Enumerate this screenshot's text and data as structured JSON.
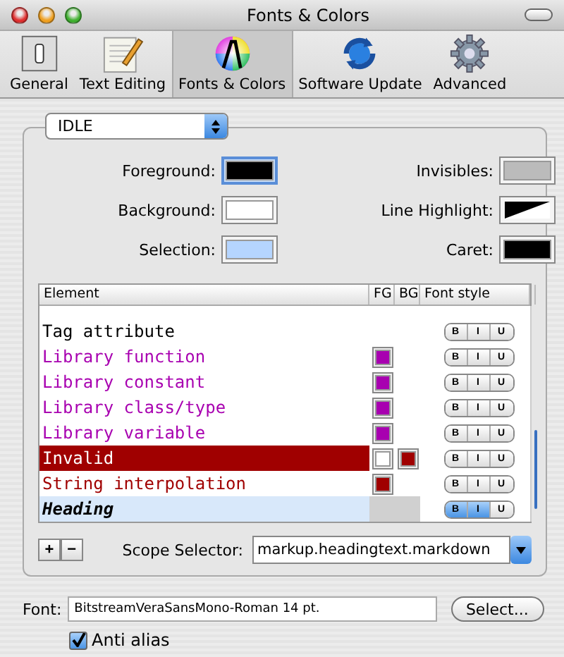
{
  "window": {
    "title": "Fonts & Colors"
  },
  "toolbar": [
    {
      "label": "General",
      "kind": "switch",
      "selected": false
    },
    {
      "label": "Text Editing",
      "kind": "notepad",
      "selected": false
    },
    {
      "label": "Fonts & Colors",
      "kind": "colorwheel",
      "selected": true
    },
    {
      "label": "Software Update",
      "kind": "sync",
      "selected": false
    },
    {
      "label": "Advanced",
      "kind": "gear",
      "selected": false
    }
  ],
  "theme_popup": {
    "value": "IDLE"
  },
  "colors": [
    {
      "label": "Foreground:",
      "color": "#000000",
      "kind": "solid",
      "focused": true
    },
    {
      "label": "Invisibles:",
      "color": "#bbbbbb",
      "kind": "solid",
      "focused": false
    },
    {
      "label": "Background:",
      "color": "#ffffff",
      "kind": "solid",
      "focused": false
    },
    {
      "label": "Line Highlight:",
      "color": "#000000",
      "kind": "diagonal",
      "focused": false
    },
    {
      "label": "Selection:",
      "color": "#b5d5ff",
      "kind": "solid",
      "focused": false
    },
    {
      "label": "Caret:",
      "color": "#000000",
      "kind": "solid",
      "focused": false
    }
  ],
  "table": {
    "columns": [
      "Element",
      "FG",
      "BG",
      "Font style"
    ],
    "rows": [
      {
        "name": "Tag attribute",
        "fg": null,
        "bg": null,
        "selected": false,
        "styles": [
          {
            "label": "B",
            "on": false
          },
          {
            "label": "I",
            "on": false
          },
          {
            "label": "U",
            "on": false
          }
        ]
      },
      {
        "name": "Library function",
        "fg": {
          "color": "#a800b0"
        },
        "bg": null,
        "selected": false,
        "styles": [
          {
            "label": "B",
            "on": false
          },
          {
            "label": "I",
            "on": false
          },
          {
            "label": "U",
            "on": false
          }
        ]
      },
      {
        "name": "Library constant",
        "fg": {
          "color": "#a800b0"
        },
        "bg": null,
        "selected": false,
        "styles": [
          {
            "label": "B",
            "on": false
          },
          {
            "label": "I",
            "on": false
          },
          {
            "label": "U",
            "on": false
          }
        ]
      },
      {
        "name": "Library class/type",
        "fg": {
          "color": "#a800b0"
        },
        "bg": null,
        "selected": false,
        "styles": [
          {
            "label": "B",
            "on": false
          },
          {
            "label": "I",
            "on": false
          },
          {
            "label": "U",
            "on": false
          }
        ]
      },
      {
        "name": "Library variable",
        "fg": {
          "color": "#a800b0"
        },
        "bg": null,
        "selected": false,
        "styles": [
          {
            "label": "B",
            "on": false
          },
          {
            "label": "I",
            "on": false
          },
          {
            "label": "U",
            "on": false
          }
        ]
      },
      {
        "name": "Invalid",
        "fg": {
          "color": "#ffffff"
        },
        "bg": {
          "color": "#a00000"
        },
        "selected": false,
        "styles": [
          {
            "label": "B",
            "on": false
          },
          {
            "label": "I",
            "on": false
          },
          {
            "label": "U",
            "on": false
          }
        ]
      },
      {
        "name": "String interpolation",
        "fg": {
          "color": "#a00000"
        },
        "bg": null,
        "selected": false,
        "styles": [
          {
            "label": "B",
            "on": false
          },
          {
            "label": "I",
            "on": false
          },
          {
            "label": "U",
            "on": false
          }
        ]
      },
      {
        "name": "Heading",
        "fg": null,
        "bg": null,
        "selected": true,
        "styles": [
          {
            "label": "B",
            "on": true
          },
          {
            "label": "I",
            "on": true
          },
          {
            "label": "U",
            "on": false
          }
        ]
      }
    ]
  },
  "row_buttons": [
    "+",
    "−"
  ],
  "scope": {
    "label": "Scope Selector:",
    "value": "markup.headingtext.markdown"
  },
  "font": {
    "label": "Font:",
    "value": "BitstreamVeraSansMono-Roman 14 pt.",
    "button": "Select..."
  },
  "anti_alias": {
    "label": "Anti alias",
    "checked": true
  }
}
